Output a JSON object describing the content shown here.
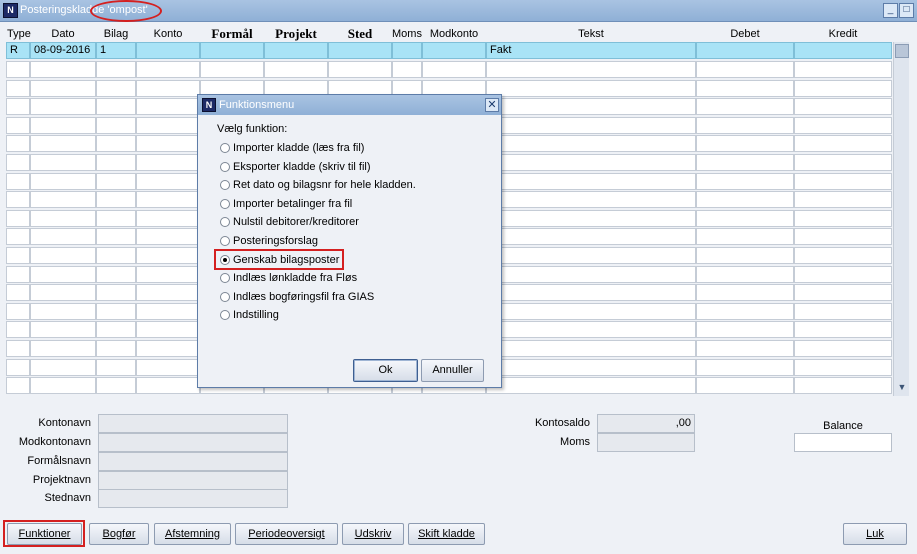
{
  "window": {
    "title": "Posteringskladde 'ompost'",
    "minimize_glyph": "_",
    "maximize_glyph": "□"
  },
  "grid": {
    "columns": [
      "Type",
      "Dato",
      "Bilag",
      "Konto",
      "Formål",
      "Projekt",
      "Sted",
      "Moms",
      "Modkonto",
      "Tekst",
      "Debet",
      "Kredit"
    ],
    "rows": [
      {
        "type": "R",
        "dato": "08-09-2016",
        "bilag": "1",
        "konto": "",
        "formaal": "",
        "projekt": "",
        "sted": "",
        "moms": "",
        "modkonto": "",
        "tekst": "Fakt",
        "debet": "",
        "kredit": ""
      }
    ],
    "empty_row_count": 18,
    "scroll_down_glyph": "▼"
  },
  "footer_fields": {
    "kontonavn_label": "Kontonavn",
    "modkontonavn_label": "Modkontonavn",
    "formaalsnavn_label": "Formålsnavn",
    "projektnavn_label": "Projektnavn",
    "stednavn_label": "Stednavn",
    "kontosaldo_label": "Kontosaldo",
    "kontosaldo_value": ",00",
    "moms_label": "Moms",
    "moms_value": "",
    "balance_label": "Balance",
    "balance_value": ""
  },
  "buttons": {
    "funktioner": "Funktioner",
    "bogfor": "Bogfør",
    "afstemning": "Afstemning",
    "periodeoversigt": "Periodeoversigt",
    "udskriv": "Udskriv",
    "skift_kladde": "Skift kladde",
    "luk": "Luk"
  },
  "dialog": {
    "title": "Funktionsmenu",
    "close_glyph": "✕",
    "prompt": "Vælg funktion:",
    "options": [
      {
        "label": "Importer kladde (læs fra fil)",
        "selected": false
      },
      {
        "label": "Eksporter kladde (skriv til fil)",
        "selected": false
      },
      {
        "label": "Ret dato og bilagsnr for hele kladden.",
        "selected": false
      },
      {
        "label": "Importer betalinger fra fil",
        "selected": false
      },
      {
        "label": "Nulstil debitorer/kreditorer",
        "selected": false
      },
      {
        "label": "Posteringsforslag",
        "selected": false
      },
      {
        "label": "Genskab bilagsposter",
        "selected": true
      },
      {
        "label": "Indlæs lønkladde fra Fløs",
        "selected": false
      },
      {
        "label": "Indlæs bogføringsfil fra GIAS",
        "selected": false
      },
      {
        "label": "Indstilling",
        "selected": false
      }
    ],
    "ok_label": "Ok",
    "cancel_label": "Annuller"
  },
  "colors": {
    "selected_row": "#a9e3f6",
    "highlight_ring": "#d42020",
    "titlebar": "#8fb0d6"
  }
}
